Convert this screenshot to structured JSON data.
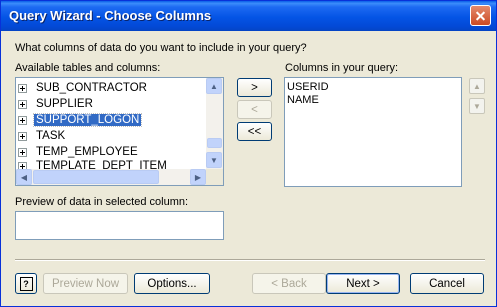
{
  "window": {
    "title": "Query Wizard - Choose Columns"
  },
  "question": "What columns of data do you want to include in your query?",
  "available": {
    "label": "Available tables and columns:",
    "items": [
      {
        "text": "SUB_CONTRACTOR",
        "selected": false
      },
      {
        "text": "SUPPLIER",
        "selected": false
      },
      {
        "text": "SUPPORT_LOGON",
        "selected": true
      },
      {
        "text": "TASK",
        "selected": false
      },
      {
        "text": "TEMP_EMPLOYEE",
        "selected": false
      },
      {
        "text": "TEMPLATE_DEPT_ITEM",
        "selected": false
      }
    ]
  },
  "move_buttons": {
    "add": ">",
    "remove": "<",
    "remove_all": "<<"
  },
  "selected": {
    "label": "Columns in your query:",
    "items": [
      "USERID",
      "NAME"
    ]
  },
  "preview": {
    "label": "Preview of data in selected column:",
    "value": ""
  },
  "buttons": {
    "help": "?",
    "preview_now": "Preview Now",
    "options": "Options...",
    "back": "< Back",
    "next": "Next >",
    "cancel": "Cancel"
  }
}
